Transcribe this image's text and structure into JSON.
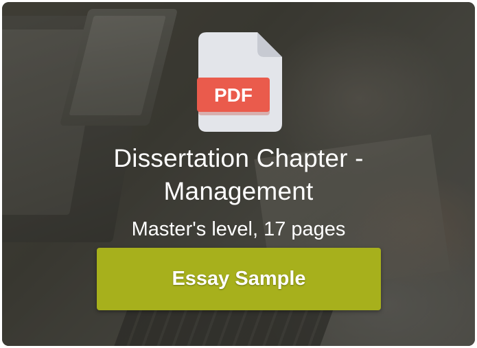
{
  "card": {
    "file_badge": "PDF",
    "title_line_1": "Dissertation Chapter -",
    "title_line_2": "Management",
    "subtitle": "Master's level, 17 pages",
    "cta_label": "Essay Sample"
  },
  "colors": {
    "cta_background": "#a7b01c",
    "pdf_badge": "#ea5b4c",
    "pdf_page": "#e3e5ea",
    "pdf_fold": "#c7cad2"
  },
  "icons": {
    "document": "pdf-file-icon"
  }
}
